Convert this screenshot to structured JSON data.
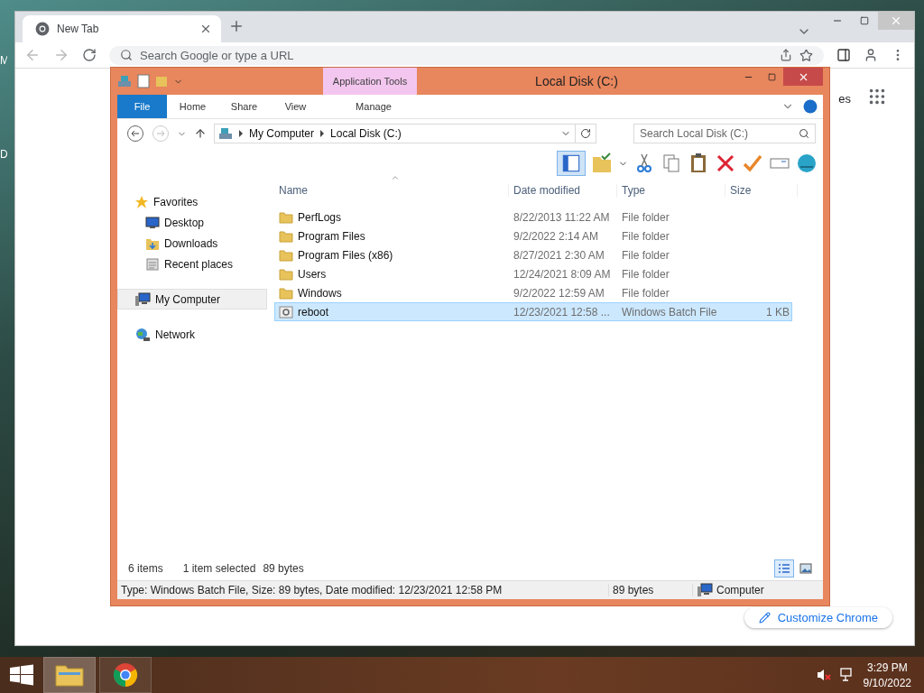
{
  "desktop": {
    "icon_labels": [
      "M",
      "D"
    ]
  },
  "chrome": {
    "tabs": [
      {
        "label": "New Tab",
        "selected": true
      }
    ],
    "omnibox": {
      "placeholder": "Search Google or type a URL"
    },
    "partial_link": "es",
    "customize_button": "Customize Chrome"
  },
  "explorer": {
    "title": "Local Disk (C:)",
    "context_tab": "Application Tools",
    "ribbon_tabs": [
      {
        "label": "File",
        "kind": "file"
      },
      {
        "label": "Home",
        "kind": "normal"
      },
      {
        "label": "Share",
        "kind": "normal"
      },
      {
        "label": "View",
        "kind": "normal"
      },
      {
        "label": "Manage",
        "kind": "context"
      }
    ],
    "breadcrumbs": [
      "My Computer",
      "Local Disk (C:)"
    ],
    "search": {
      "placeholder": "Search Local Disk (C:)"
    },
    "nav": [
      {
        "label": "Favorites",
        "kind": "favorites",
        "selected": false,
        "children": [
          {
            "label": "Desktop",
            "kind": "desktop",
            "selected": false
          },
          {
            "label": "Downloads",
            "kind": "downloads",
            "selected": false
          },
          {
            "label": "Recent places",
            "kind": "recent",
            "selected": false
          }
        ]
      },
      {
        "label": "My Computer",
        "kind": "computer",
        "selected": true
      },
      {
        "label": "Network",
        "kind": "network",
        "selected": false
      }
    ],
    "columns": [
      "Name",
      "Date modified",
      "Type",
      "Size"
    ],
    "rows": [
      {
        "name": "PerfLogs",
        "date": "8/22/2013 11:22 AM",
        "type": "File folder",
        "kind": "folder",
        "selected": false
      },
      {
        "name": "Program Files",
        "date": "9/2/2022 2:14 AM",
        "type": "File folder",
        "kind": "folder",
        "selected": false
      },
      {
        "name": "Program Files (x86)",
        "date": "8/27/2021 2:30 AM",
        "type": "File folder",
        "kind": "folder",
        "selected": false
      },
      {
        "name": "Users",
        "date": "12/24/2021 8:09 AM",
        "type": "File folder",
        "kind": "folder",
        "selected": false
      },
      {
        "name": "Windows",
        "date": "9/2/2022 12:59 AM",
        "type": "File folder",
        "kind": "folder",
        "selected": false
      },
      {
        "name": "reboot",
        "date": "12/23/2021 12:58 ...",
        "type": "Windows Batch File",
        "size": "1 KB",
        "kind": "batch",
        "selected": true
      }
    ],
    "status": {
      "count": "6 items",
      "selection": "1 item selected",
      "selection_size": "89 bytes"
    },
    "view_buttons": [
      {
        "kind": "details",
        "selected": true
      },
      {
        "kind": "large",
        "selected": false
      }
    ],
    "details_bar": {
      "info": "Type: Windows Batch File, Size: 89 bytes, Date modified: 12/23/2021 12:58 PM",
      "size": "89 bytes",
      "location": "Computer"
    }
  },
  "taskbar": {
    "buttons": [
      {
        "kind": "explorer",
        "selected": true
      },
      {
        "kind": "chrome",
        "selected": false
      }
    ],
    "time": "3:29 PM",
    "date": "9/10/2022"
  }
}
